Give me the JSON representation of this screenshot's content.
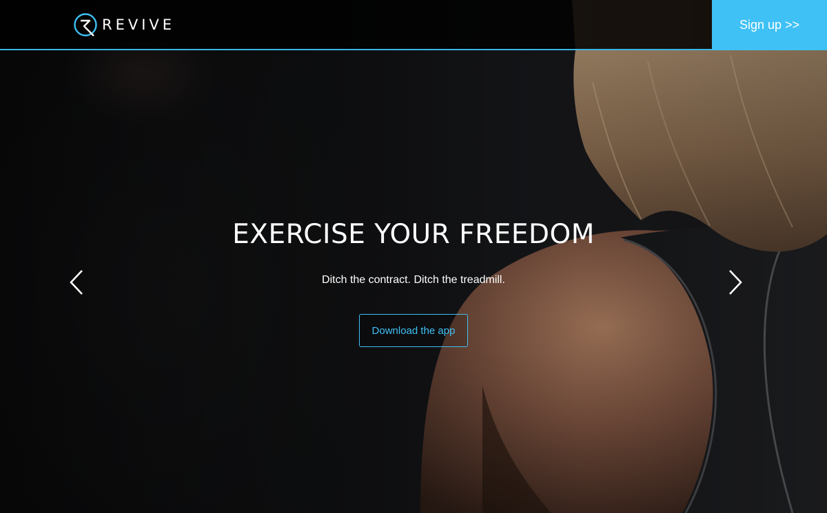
{
  "brand": {
    "name": "REVIVE",
    "accent_color": "#3fc1f5",
    "logo_icon": "revive-r-logo-icon"
  },
  "header": {
    "signup_label": "Sign up >>"
  },
  "hero": {
    "headline": "EXERCISE YOUR FREEDOM",
    "subline": "Ditch the contract. Ditch the treadmill.",
    "cta_label": "Download the app",
    "prev_icon": "chevron-left-icon",
    "next_icon": "chevron-right-icon"
  }
}
